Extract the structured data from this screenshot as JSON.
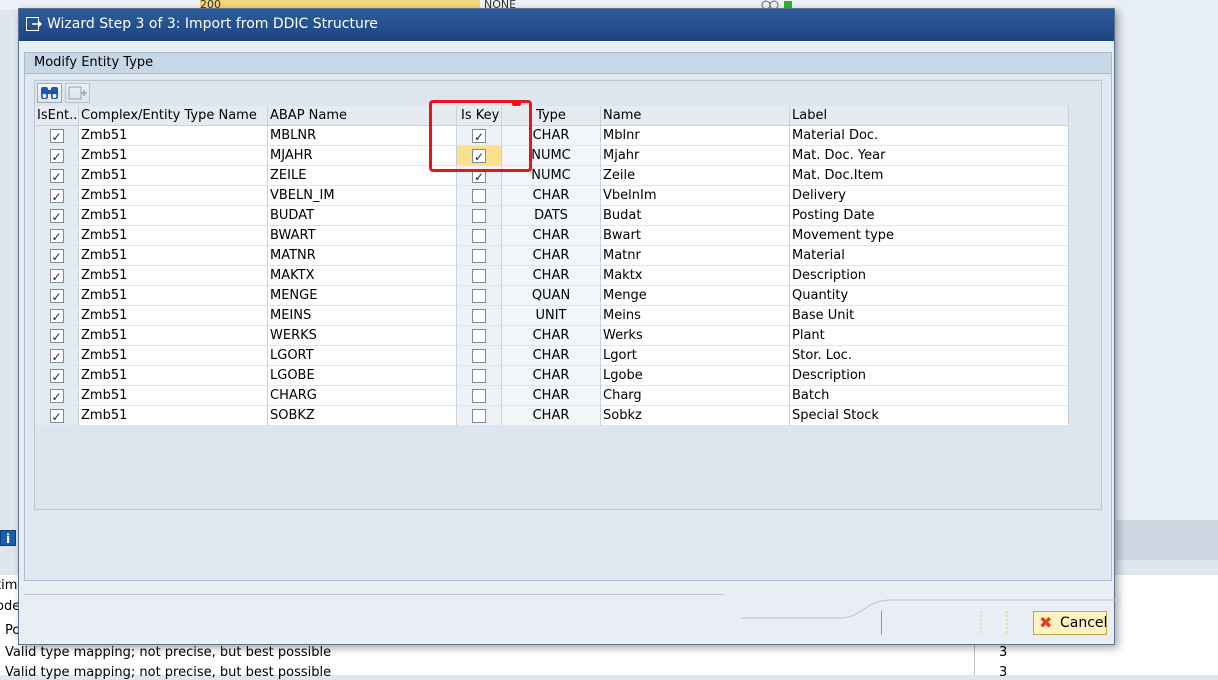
{
  "background": {
    "top_value": "200",
    "top_none": "NONE",
    "info_icon": "info-icon",
    "bottom_lines": [
      {
        "text": "time",
        "visible": "ime"
      },
      {
        "text": "ode",
        "visible": "ode"
      },
      {
        "text": "Po",
        "visible": "Po"
      },
      {
        "text": "Valid type mapping; not precise, but best possible",
        "num": "3"
      },
      {
        "text": "Valid type mapping; not precise, but best possible",
        "num": "3"
      }
    ]
  },
  "dialog": {
    "title": "Wizard Step 3 of 3: Import from DDIC Structure",
    "title_icon": "wizard-icon",
    "group_title": "Modify Entity Type",
    "toolbar": {
      "btn1_icon": "binoculars-icon",
      "btn2_icon": "add-row-icon"
    },
    "columns": [
      "IsEnt...",
      "Complex/Entity Type Name",
      "ABAP Name",
      "Is Key",
      "Type",
      "Name",
      "Label"
    ],
    "rows": [
      {
        "is_entity": true,
        "entity": "Zmb51",
        "abap": "MBLNR",
        "is_key": true,
        "type": "CHAR",
        "name": "Mblnr",
        "label": "Material Doc."
      },
      {
        "is_entity": true,
        "entity": "Zmb51",
        "abap": "MJAHR",
        "is_key": true,
        "type": "NUMC",
        "name": "Mjahr",
        "label": "Mat. Doc. Year"
      },
      {
        "is_entity": true,
        "entity": "Zmb51",
        "abap": "ZEILE",
        "is_key": true,
        "type": "NUMC",
        "name": "Zeile",
        "label": "Mat. Doc.Item"
      },
      {
        "is_entity": true,
        "entity": "Zmb51",
        "abap": "VBELN_IM",
        "is_key": false,
        "type": "CHAR",
        "name": "VbelnIm",
        "label": "Delivery"
      },
      {
        "is_entity": true,
        "entity": "Zmb51",
        "abap": "BUDAT",
        "is_key": false,
        "type": "DATS",
        "name": "Budat",
        "label": "Posting Date"
      },
      {
        "is_entity": true,
        "entity": "Zmb51",
        "abap": "BWART",
        "is_key": false,
        "type": "CHAR",
        "name": "Bwart",
        "label": "Movement type"
      },
      {
        "is_entity": true,
        "entity": "Zmb51",
        "abap": "MATNR",
        "is_key": false,
        "type": "CHAR",
        "name": "Matnr",
        "label": "Material"
      },
      {
        "is_entity": true,
        "entity": "Zmb51",
        "abap": "MAKTX",
        "is_key": false,
        "type": "CHAR",
        "name": "Maktx",
        "label": "Description"
      },
      {
        "is_entity": true,
        "entity": "Zmb51",
        "abap": "MENGE",
        "is_key": false,
        "type": "QUAN",
        "name": "Menge",
        "label": "Quantity"
      },
      {
        "is_entity": true,
        "entity": "Zmb51",
        "abap": "MEINS",
        "is_key": false,
        "type": "UNIT",
        "name": "Meins",
        "label": "Base Unit"
      },
      {
        "is_entity": true,
        "entity": "Zmb51",
        "abap": "WERKS",
        "is_key": false,
        "type": "CHAR",
        "name": "Werks",
        "label": "Plant"
      },
      {
        "is_entity": true,
        "entity": "Zmb51",
        "abap": "LGORT",
        "is_key": false,
        "type": "CHAR",
        "name": "Lgort",
        "label": "Stor. Loc."
      },
      {
        "is_entity": true,
        "entity": "Zmb51",
        "abap": "LGOBE",
        "is_key": false,
        "type": "CHAR",
        "name": "Lgobe",
        "label": "Description"
      },
      {
        "is_entity": true,
        "entity": "Zmb51",
        "abap": "CHARG",
        "is_key": false,
        "type": "CHAR",
        "name": "Charg",
        "label": "Batch"
      },
      {
        "is_entity": true,
        "entity": "Zmb51",
        "abap": "SOBKZ",
        "is_key": false,
        "type": "CHAR",
        "name": "Sobkz",
        "label": "Special Stock"
      }
    ],
    "cancel_label": "Cancel",
    "cancel_icon": "cancel-x-icon",
    "highlight_color": "#e8141c",
    "focus_color": "#fbe08d"
  }
}
